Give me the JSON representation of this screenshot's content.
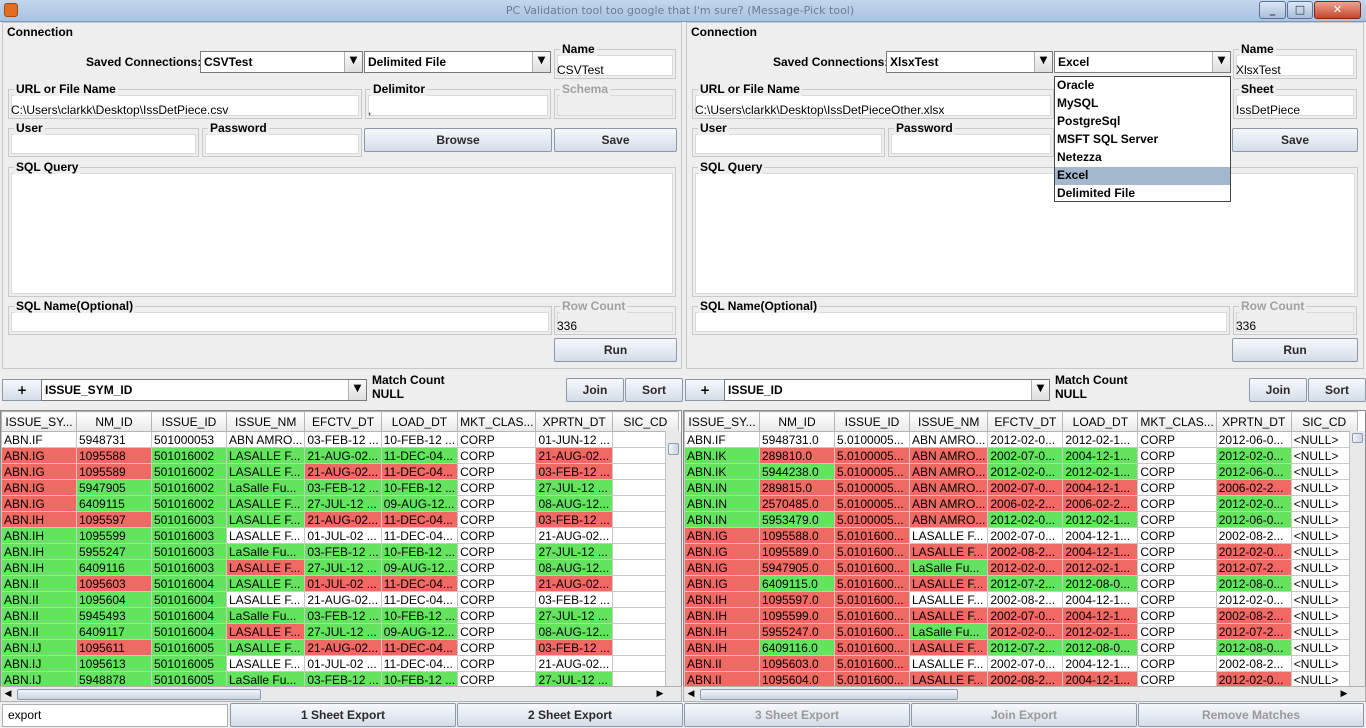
{
  "window": {
    "title": "PC Validation tool too google that I'm sure? (Message-Pick tool)"
  },
  "left": {
    "section_title": "Connection",
    "saved_connections_label": "Saved Connections:",
    "saved_connection": "CSVTest",
    "source_type": "Delimited File",
    "name_label": "Name",
    "name_value": "CSVTest",
    "url_label": "URL or File Name",
    "url_value": "C:\\Users\\clarkk\\Desktop\\IssDetPiece.csv",
    "delimitor_label": "Delimitor",
    "delimitor_value": ",",
    "schema_label": "Schema",
    "user_label": "User",
    "password_label": "Password",
    "browse_label": "Browse",
    "save_label": "Save",
    "sql_query_label": "SQL Query",
    "sql_name_label": "SQL Name(Optional)",
    "row_count_label": "Row Count",
    "row_count_value": "336",
    "run_label": "Run"
  },
  "right": {
    "section_title": "Connection",
    "saved_connections_label": "Saved Connections:",
    "saved_connection": "XlsxTest",
    "source_type": "Excel",
    "name_label": "Name",
    "name_value": "XlsxTest",
    "url_label": "URL or File Name",
    "url_value": "C:\\Users\\clarkk\\Desktop\\IssDetPieceOther.xlsx",
    "sheet_label": "Sheet",
    "sheet_value": "IssDetPiece",
    "user_label": "User",
    "password_label": "Password",
    "save_label": "Save",
    "sql_query_label": "SQL Query",
    "sql_name_label": "SQL Name(Optional)",
    "row_count_label": "Row Count",
    "row_count_value": "336",
    "run_label": "Run",
    "dropdown_options": [
      "Oracle",
      "MySQL",
      "PostgreSql",
      "MSFT SQL Server",
      "Netezza",
      "Excel",
      "Delimited File"
    ],
    "dropdown_selected": "Excel"
  },
  "match": {
    "plus_label": "+",
    "left_column": "ISSUE_SYM_ID",
    "match_count_label": "Match Count",
    "match_count_value": "NULL",
    "join_label": "Join",
    "sort_label": "Sort",
    "right_plus_label": "+",
    "right_column": "ISSUE_ID",
    "right_match_count_label": "Match Count",
    "right_match_count_value": "NULL",
    "right_join_label": "Join",
    "right_sort_label": "Sort"
  },
  "left_table": {
    "columns": [
      "ISSUE_SY...",
      "NM_ID",
      "ISSUE_ID",
      "ISSUE_NM",
      "EFCTV_DT",
      "LOAD_DT",
      "MKT_CLAS...",
      "XPRTN_DT",
      "SIC_CD"
    ],
    "rows": [
      [
        "ABN.IF",
        "5948731",
        "501000053",
        "ABN AMRO...",
        "03-FEB-12 ...",
        "10-FEB-12 ...",
        "CORP",
        "01-JUN-12 ...",
        ""
      ],
      [
        "ABN.IG",
        "1095588",
        "501016002",
        "LASALLE F...",
        "21-AUG-02...",
        "11-DEC-04...",
        "CORP",
        "21-AUG-02...",
        ""
      ],
      [
        "ABN.IG",
        "1095589",
        "501016002",
        "LASALLE F...",
        "21-AUG-02...",
        "11-DEC-04...",
        "CORP",
        "03-FEB-12 ...",
        ""
      ],
      [
        "ABN.IG",
        "5947905",
        "501016002",
        "LaSalle Fu...",
        "03-FEB-12 ...",
        "10-FEB-12 ...",
        "CORP",
        "27-JUL-12 ...",
        ""
      ],
      [
        "ABN.IG",
        "6409115",
        "501016002",
        "LASALLE F...",
        "27-JUL-12 ...",
        "09-AUG-12...",
        "CORP",
        "08-AUG-12...",
        ""
      ],
      [
        "ABN.IH",
        "1095597",
        "501016003",
        "LASALLE F...",
        "21-AUG-02...",
        "11-DEC-04...",
        "CORP",
        "03-FEB-12 ...",
        ""
      ],
      [
        "ABN.IH",
        "1095599",
        "501016003",
        "LASALLE F...",
        "01-JUL-02 ...",
        "11-DEC-04...",
        "CORP",
        "21-AUG-02...",
        ""
      ],
      [
        "ABN.IH",
        "5955247",
        "501016003",
        "LaSalle Fu...",
        "03-FEB-12 ...",
        "10-FEB-12 ...",
        "CORP",
        "27-JUL-12 ...",
        ""
      ],
      [
        "ABN.IH",
        "6409116",
        "501016003",
        "LASALLE F...",
        "27-JUL-12 ...",
        "09-AUG-12...",
        "CORP",
        "08-AUG-12...",
        ""
      ],
      [
        "ABN.II",
        "1095603",
        "501016004",
        "LASALLE F...",
        "01-JUL-02 ...",
        "11-DEC-04...",
        "CORP",
        "21-AUG-02...",
        ""
      ],
      [
        "ABN.II",
        "1095604",
        "501016004",
        "LASALLE F...",
        "21-AUG-02...",
        "11-DEC-04...",
        "CORP",
        "03-FEB-12 ...",
        ""
      ],
      [
        "ABN.II",
        "5945493",
        "501016004",
        "LaSalle Fu...",
        "03-FEB-12 ...",
        "10-FEB-12 ...",
        "CORP",
        "27-JUL-12 ...",
        ""
      ],
      [
        "ABN.II",
        "6409117",
        "501016004",
        "LASALLE F...",
        "27-JUL-12 ...",
        "09-AUG-12...",
        "CORP",
        "08-AUG-12...",
        ""
      ],
      [
        "ABN.IJ",
        "1095611",
        "501016005",
        "LASALLE F...",
        "21-AUG-02...",
        "11-DEC-04...",
        "CORP",
        "03-FEB-12 ...",
        ""
      ],
      [
        "ABN.IJ",
        "1095613",
        "501016005",
        "LASALLE F...",
        "01-JUL-02 ...",
        "11-DEC-04...",
        "CORP",
        "21-AUG-02...",
        ""
      ],
      [
        "ABN.IJ",
        "5948878",
        "501016005",
        "LaSalle Fu...",
        "03-FEB-12 ...",
        "10-FEB-12 ...",
        "CORP",
        "27-JUL-12 ...",
        ""
      ]
    ],
    "colors": [
      [
        "",
        "",
        "",
        "",
        "",
        "",
        "",
        "",
        ""
      ],
      [
        "r",
        "r",
        "g",
        "g",
        "g",
        "g",
        "",
        "r",
        ""
      ],
      [
        "r",
        "r",
        "g",
        "g",
        "r",
        "r",
        "",
        "r",
        ""
      ],
      [
        "r",
        "g",
        "g",
        "g",
        "g",
        "g",
        "",
        "g",
        ""
      ],
      [
        "r",
        "g",
        "g",
        "g",
        "g",
        "g",
        "",
        "g",
        ""
      ],
      [
        "r",
        "r",
        "g",
        "g",
        "r",
        "r",
        "",
        "r",
        ""
      ],
      [
        "g",
        "g",
        "g",
        "",
        "",
        "",
        "",
        "",
        ""
      ],
      [
        "g",
        "g",
        "g",
        "g",
        "g",
        "g",
        "",
        "g",
        ""
      ],
      [
        "g",
        "g",
        "g",
        "r",
        "g",
        "g",
        "",
        "g",
        ""
      ],
      [
        "g",
        "r",
        "g",
        "g",
        "r",
        "r",
        "",
        "r",
        ""
      ],
      [
        "g",
        "g",
        "g",
        "",
        "",
        "",
        "",
        "",
        ""
      ],
      [
        "g",
        "g",
        "g",
        "g",
        "g",
        "g",
        "",
        "g",
        ""
      ],
      [
        "g",
        "g",
        "g",
        "r",
        "g",
        "g",
        "",
        "g",
        ""
      ],
      [
        "g",
        "r",
        "g",
        "g",
        "r",
        "r",
        "",
        "r",
        ""
      ],
      [
        "g",
        "g",
        "g",
        "",
        "",
        "",
        "",
        "",
        ""
      ],
      [
        "g",
        "g",
        "g",
        "g",
        "g",
        "g",
        "",
        "g",
        ""
      ]
    ]
  },
  "right_table": {
    "columns": [
      "ISSUE_SY...",
      "NM_ID",
      "ISSUE_ID",
      "ISSUE_NM",
      "EFCTV_DT",
      "LOAD_DT",
      "MKT_CLAS...",
      "XPRTN_DT",
      "SIC_CD"
    ],
    "rows": [
      [
        "ABN.IF",
        "5948731.0",
        "5.0100005...",
        "ABN AMRO...",
        "2012-02-0...",
        "2012-02-1...",
        "CORP",
        "2012-06-0...",
        "<NULL>"
      ],
      [
        "ABN.IK",
        "289810.0",
        "5.0100005...",
        "ABN AMRO...",
        "2002-07-0...",
        "2004-12-1...",
        "CORP",
        "2012-02-0...",
        "<NULL>"
      ],
      [
        "ABN.IK",
        "5944238.0",
        "5.0100005...",
        "ABN AMRO...",
        "2012-02-0...",
        "2012-02-1...",
        "CORP",
        "2012-06-0...",
        "<NULL>"
      ],
      [
        "ABN.IN",
        "289815.0",
        "5.0100005...",
        "ABN AMRO...",
        "2002-07-0...",
        "2004-12-1...",
        "CORP",
        "2006-02-2...",
        "<NULL>"
      ],
      [
        "ABN.IN",
        "2570485.0",
        "5.0100005...",
        "ABN AMRO...",
        "2006-02-2...",
        "2006-02-2...",
        "CORP",
        "2012-02-0...",
        "<NULL>"
      ],
      [
        "ABN.IN",
        "5953479.0",
        "5.0100005...",
        "ABN AMRO...",
        "2012-02-0...",
        "2012-02-1...",
        "CORP",
        "2012-06-0...",
        "<NULL>"
      ],
      [
        "ABN.IG",
        "1095588.0",
        "5.0101600...",
        "LASALLE F...",
        "2002-07-0...",
        "2004-12-1...",
        "CORP",
        "2002-08-2...",
        "<NULL>"
      ],
      [
        "ABN.IG",
        "1095589.0",
        "5.0101600...",
        "LASALLE F...",
        "2002-08-2...",
        "2004-12-1...",
        "CORP",
        "2012-02-0...",
        "<NULL>"
      ],
      [
        "ABN.IG",
        "5947905.0",
        "5.0101600...",
        "LaSalle Fu...",
        "2012-02-0...",
        "2012-02-1...",
        "CORP",
        "2012-07-2...",
        "<NULL>"
      ],
      [
        "ABN.IG",
        "6409115.0",
        "5.0101600...",
        "LASALLE F...",
        "2012-07-2...",
        "2012-08-0...",
        "CORP",
        "2012-08-0...",
        "<NULL>"
      ],
      [
        "ABN.IH",
        "1095597.0",
        "5.0101600...",
        "LASALLE F...",
        "2002-08-2...",
        "2004-12-1...",
        "CORP",
        "2012-02-0...",
        "<NULL>"
      ],
      [
        "ABN.IH",
        "1095599.0",
        "5.0101600...",
        "LASALLE F...",
        "2002-07-0...",
        "2004-12-1...",
        "CORP",
        "2002-08-2...",
        "<NULL>"
      ],
      [
        "ABN.IH",
        "5955247.0",
        "5.0101600...",
        "LaSalle Fu...",
        "2012-02-0...",
        "2012-02-1...",
        "CORP",
        "2012-07-2...",
        "<NULL>"
      ],
      [
        "ABN.IH",
        "6409116.0",
        "5.0101600...",
        "LASALLE F...",
        "2012-07-2...",
        "2012-08-0...",
        "CORP",
        "2012-08-0...",
        "<NULL>"
      ],
      [
        "ABN.II",
        "1095603.0",
        "5.0101600...",
        "LASALLE F...",
        "2002-07-0...",
        "2004-12-1...",
        "CORP",
        "2002-08-2...",
        "<NULL>"
      ],
      [
        "ABN.II",
        "1095604.0",
        "5.0101600...",
        "LASALLE F...",
        "2002-08-2...",
        "2004-12-1...",
        "CORP",
        "2012-02-0...",
        "<NULL>"
      ]
    ],
    "colors": [
      [
        "",
        "",
        "",
        "",
        "",
        "",
        "",
        "",
        ""
      ],
      [
        "g",
        "r",
        "r",
        "r",
        "g",
        "g",
        "",
        "g",
        ""
      ],
      [
        "g",
        "g",
        "r",
        "r",
        "g",
        "g",
        "",
        "g",
        ""
      ],
      [
        "g",
        "r",
        "r",
        "r",
        "r",
        "r",
        "",
        "r",
        ""
      ],
      [
        "g",
        "r",
        "r",
        "r",
        "r",
        "r",
        "",
        "g",
        ""
      ],
      [
        "g",
        "g",
        "r",
        "r",
        "g",
        "g",
        "",
        "g",
        ""
      ],
      [
        "r",
        "r",
        "r",
        "",
        "",
        "",
        "",
        "",
        ""
      ],
      [
        "r",
        "r",
        "r",
        "r",
        "r",
        "r",
        "",
        "r",
        ""
      ],
      [
        "r",
        "r",
        "r",
        "g",
        "r",
        "r",
        "",
        "r",
        ""
      ],
      [
        "r",
        "g",
        "r",
        "r",
        "g",
        "g",
        "",
        "g",
        ""
      ],
      [
        "r",
        "r",
        "r",
        "",
        "",
        "",
        "",
        "",
        ""
      ],
      [
        "r",
        "r",
        "r",
        "r",
        "r",
        "r",
        "",
        "r",
        ""
      ],
      [
        "r",
        "r",
        "r",
        "g",
        "r",
        "r",
        "",
        "r",
        ""
      ],
      [
        "r",
        "g",
        "r",
        "r",
        "g",
        "g",
        "",
        "g",
        ""
      ],
      [
        "r",
        "r",
        "r",
        "",
        "",
        "",
        "",
        "",
        ""
      ],
      [
        "r",
        "r",
        "r",
        "r",
        "r",
        "r",
        "",
        "r",
        ""
      ]
    ]
  },
  "bottom": {
    "export_name": "export",
    "sheet1_export": "1 Sheet Export",
    "sheet2_export": "2 Sheet Export",
    "sheet3_export": "3 Sheet Export",
    "join_export": "Join Export",
    "remove_matches": "Remove Matches"
  },
  "colors": {
    "match_green": "#64e45e",
    "mismatch_red": "#ef6a62",
    "panel_bg": "#eeeeee"
  }
}
